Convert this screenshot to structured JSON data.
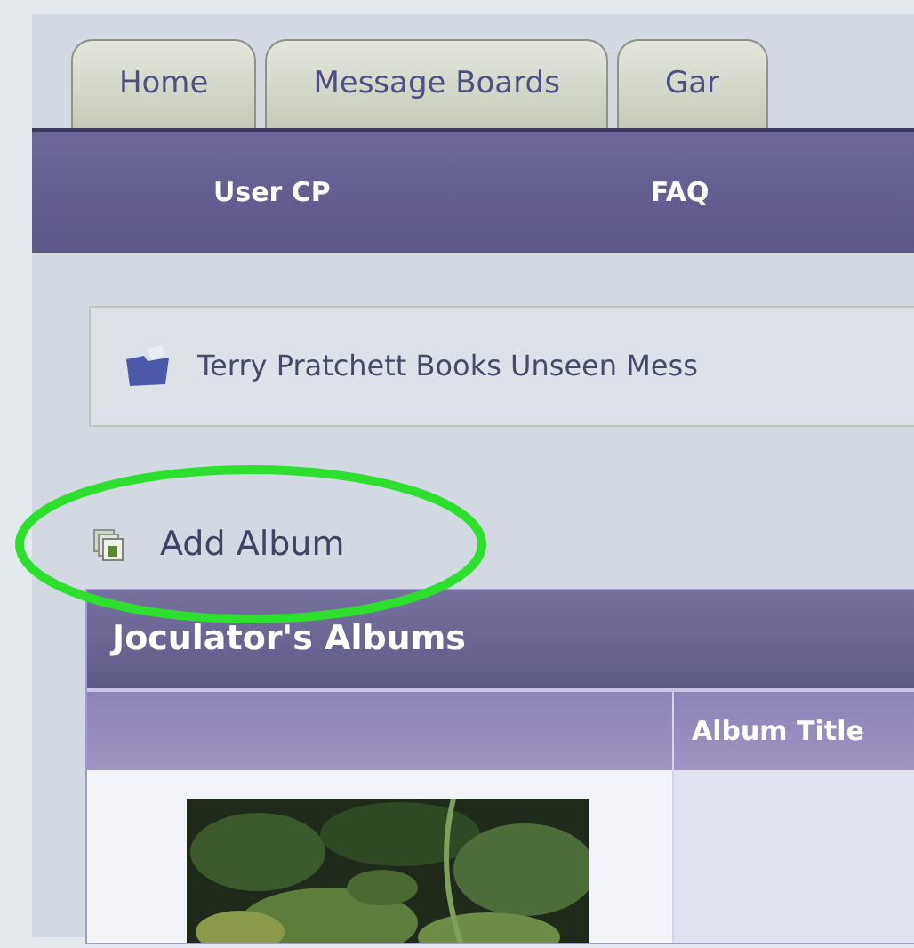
{
  "tabs": [
    {
      "label": "Home"
    },
    {
      "label": "Message Boards"
    },
    {
      "label": "Gar"
    }
  ],
  "nav_links": [
    "User CP",
    "FAQ"
  ],
  "breadcrumb": {
    "text": "Terry Pratchett Books Unseen Mess"
  },
  "add_album_link": "Add Album",
  "albums_table": {
    "title": "Joculator's Albums",
    "column_2_header": "Album Title"
  }
}
